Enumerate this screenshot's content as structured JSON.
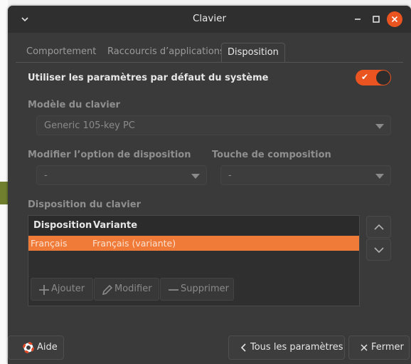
{
  "window": {
    "title": "Clavier"
  },
  "tabs": [
    {
      "label": "Comportement"
    },
    {
      "label": "Raccourcis d’applications"
    },
    {
      "label": "Disposition"
    }
  ],
  "defaults": {
    "label": "Utiliser les paramètres par défaut du système",
    "enabled": true
  },
  "model": {
    "label": "Modèle du clavier",
    "value": "Generic 105-key PC"
  },
  "layout_option": {
    "label": "Modifier l’option de disposition",
    "value": "-"
  },
  "compose_key": {
    "label": "Touche de composition",
    "value": "-"
  },
  "layouts": {
    "label": "Disposition du clavier",
    "columns": [
      "Disposition",
      "Variante"
    ],
    "rows": [
      {
        "layout": "Français",
        "variant": "Français (variante)"
      }
    ]
  },
  "toolbar": {
    "add": "Ajouter",
    "edit": "Modifier",
    "remove": "Supprimer"
  },
  "footer": {
    "help": "Aide",
    "all_settings": "Tous les paramètres",
    "close": "Fermer"
  },
  "colors": {
    "accent": "#e95420",
    "selection": "#f07a37",
    "window_bg": "#3a3a3a"
  }
}
